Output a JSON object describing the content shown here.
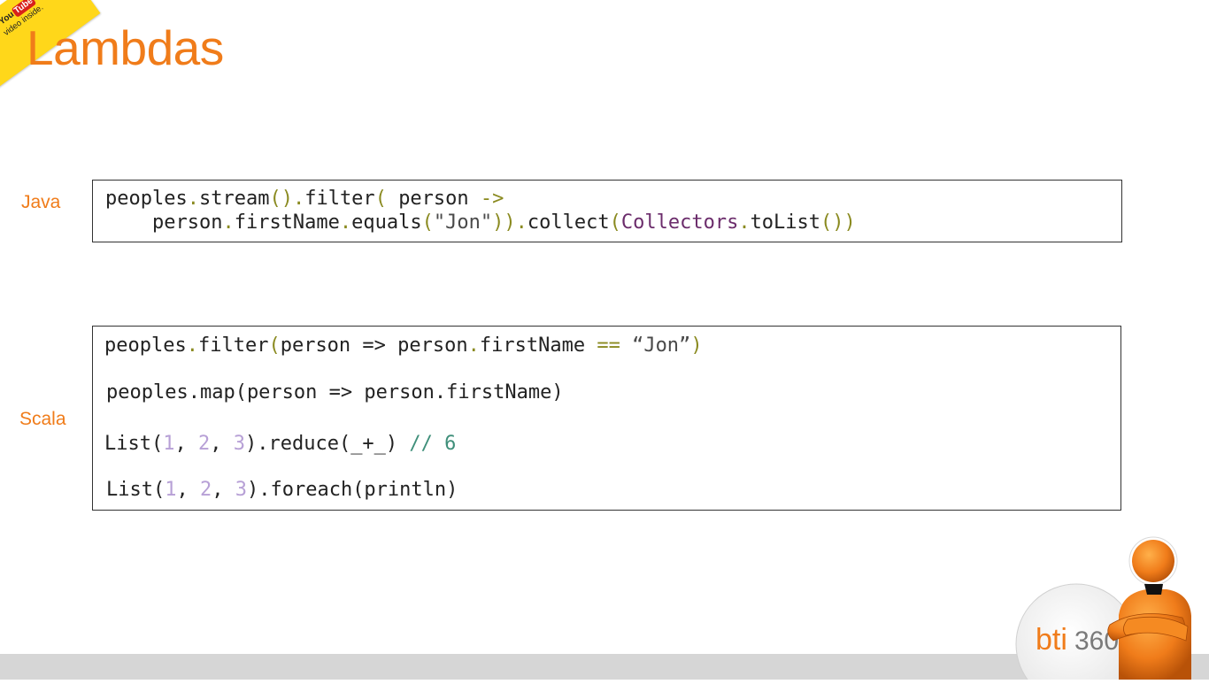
{
  "badge": {
    "logo_prefix": "You",
    "logo_suffix": "Tube",
    "subtitle": "video inside."
  },
  "slide": {
    "title": "Lambdas",
    "labels": {
      "java": "Java",
      "scala": "Scala"
    }
  },
  "java_code": {
    "line1": {
      "a": "peoples",
      "b": ".",
      "c": "stream",
      "d": "().",
      "e": "filter",
      "f": "( ",
      "g": "person ",
      "h": "->"
    },
    "line2": {
      "a": "    person",
      "b": ".",
      "c": "firstName",
      "d": ".",
      "e": "equals",
      "f": "(",
      "g": "\"Jon\"",
      "h": ")).",
      "i": "collect",
      "j": "(",
      "k": "Collectors",
      "l": ".",
      "m": "toList",
      "n": "())"
    }
  },
  "scala_code": {
    "line1": {
      "a": "peoples",
      "b": ".",
      "c": "filter",
      "d": "(",
      "e": "person => person",
      "f": ".",
      "g": "firstName ",
      "h": "==",
      "i": " “Jon”",
      "j": ")"
    },
    "line2": "peoples.map(person => person.firstName)",
    "line3": {
      "a": "List(",
      "b": "1",
      "c": ", ",
      "d": "2",
      "e": ", ",
      "f": "3",
      "g": ").reduce(_+_) ",
      "h": "// 6"
    },
    "line4": {
      "a": "List(",
      "b": "1",
      "c": ", ",
      "d": "2",
      "e": ", ",
      "f": "3",
      "g": ").foreach(println)"
    }
  },
  "logo": {
    "brand_a": "bti",
    "brand_b": "360"
  },
  "colors": {
    "accent": "#f07c1a",
    "footer": "#d6d6d6",
    "badge": "#ffd71a"
  }
}
